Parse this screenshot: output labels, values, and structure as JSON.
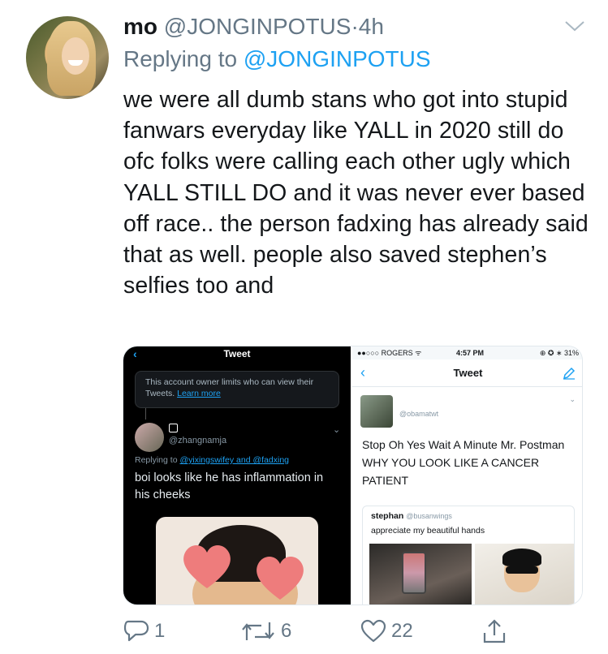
{
  "tweet": {
    "display_name": "mo",
    "handle": "@JONGINPOTUS",
    "separator": "·",
    "time": "4h",
    "replying_prefix": "Replying to",
    "replying_to": "@JONGINPOTUS",
    "text": "we were all dumb stans who got into stupid fanwars everyday like YALL in 2020 still do ofc folks were calling each other ugly which YALL STILL DO and it was never ever based off race.. the person fadxing has already said that as well. people also saved stephen’s selfies too and",
    "avatar_icon": "profile-photo",
    "menu_icon": "chevron-down-icon"
  },
  "left_screenshot": {
    "back": "‹",
    "title": "Tweet",
    "notice_text": "This account owner limits who can view their Tweets.",
    "notice_link": "Learn more",
    "handle": "@zhangnamja",
    "replying_prefix": "Replying to",
    "replying_users": "@yixingswifey and @fadxing",
    "text": "boi looks like he has inflammation in his cheeks",
    "caret": "⌄"
  },
  "right_screenshot": {
    "carrier": "●●○○○ ROGERS ᯤ",
    "clock": "4:57 PM",
    "battery": "⊕ ✪ ∗ 31%",
    "back": "‹",
    "title": "Tweet",
    "handle": "@obamatwt",
    "caret": "⌄",
    "text": "Stop Oh Yes Wait A Minute Mr. Postman WHY YOU LOOK LIKE A CANCER PATIENT",
    "quote_name": "stephan",
    "quote_handle": "@busanwings",
    "quote_text": "appreciate my beautiful hands"
  },
  "actions": {
    "reply_count": "1",
    "retweet_count": "6",
    "like_count": "22",
    "colors": {
      "icon": "#657786",
      "link": "#1da1f2"
    }
  }
}
